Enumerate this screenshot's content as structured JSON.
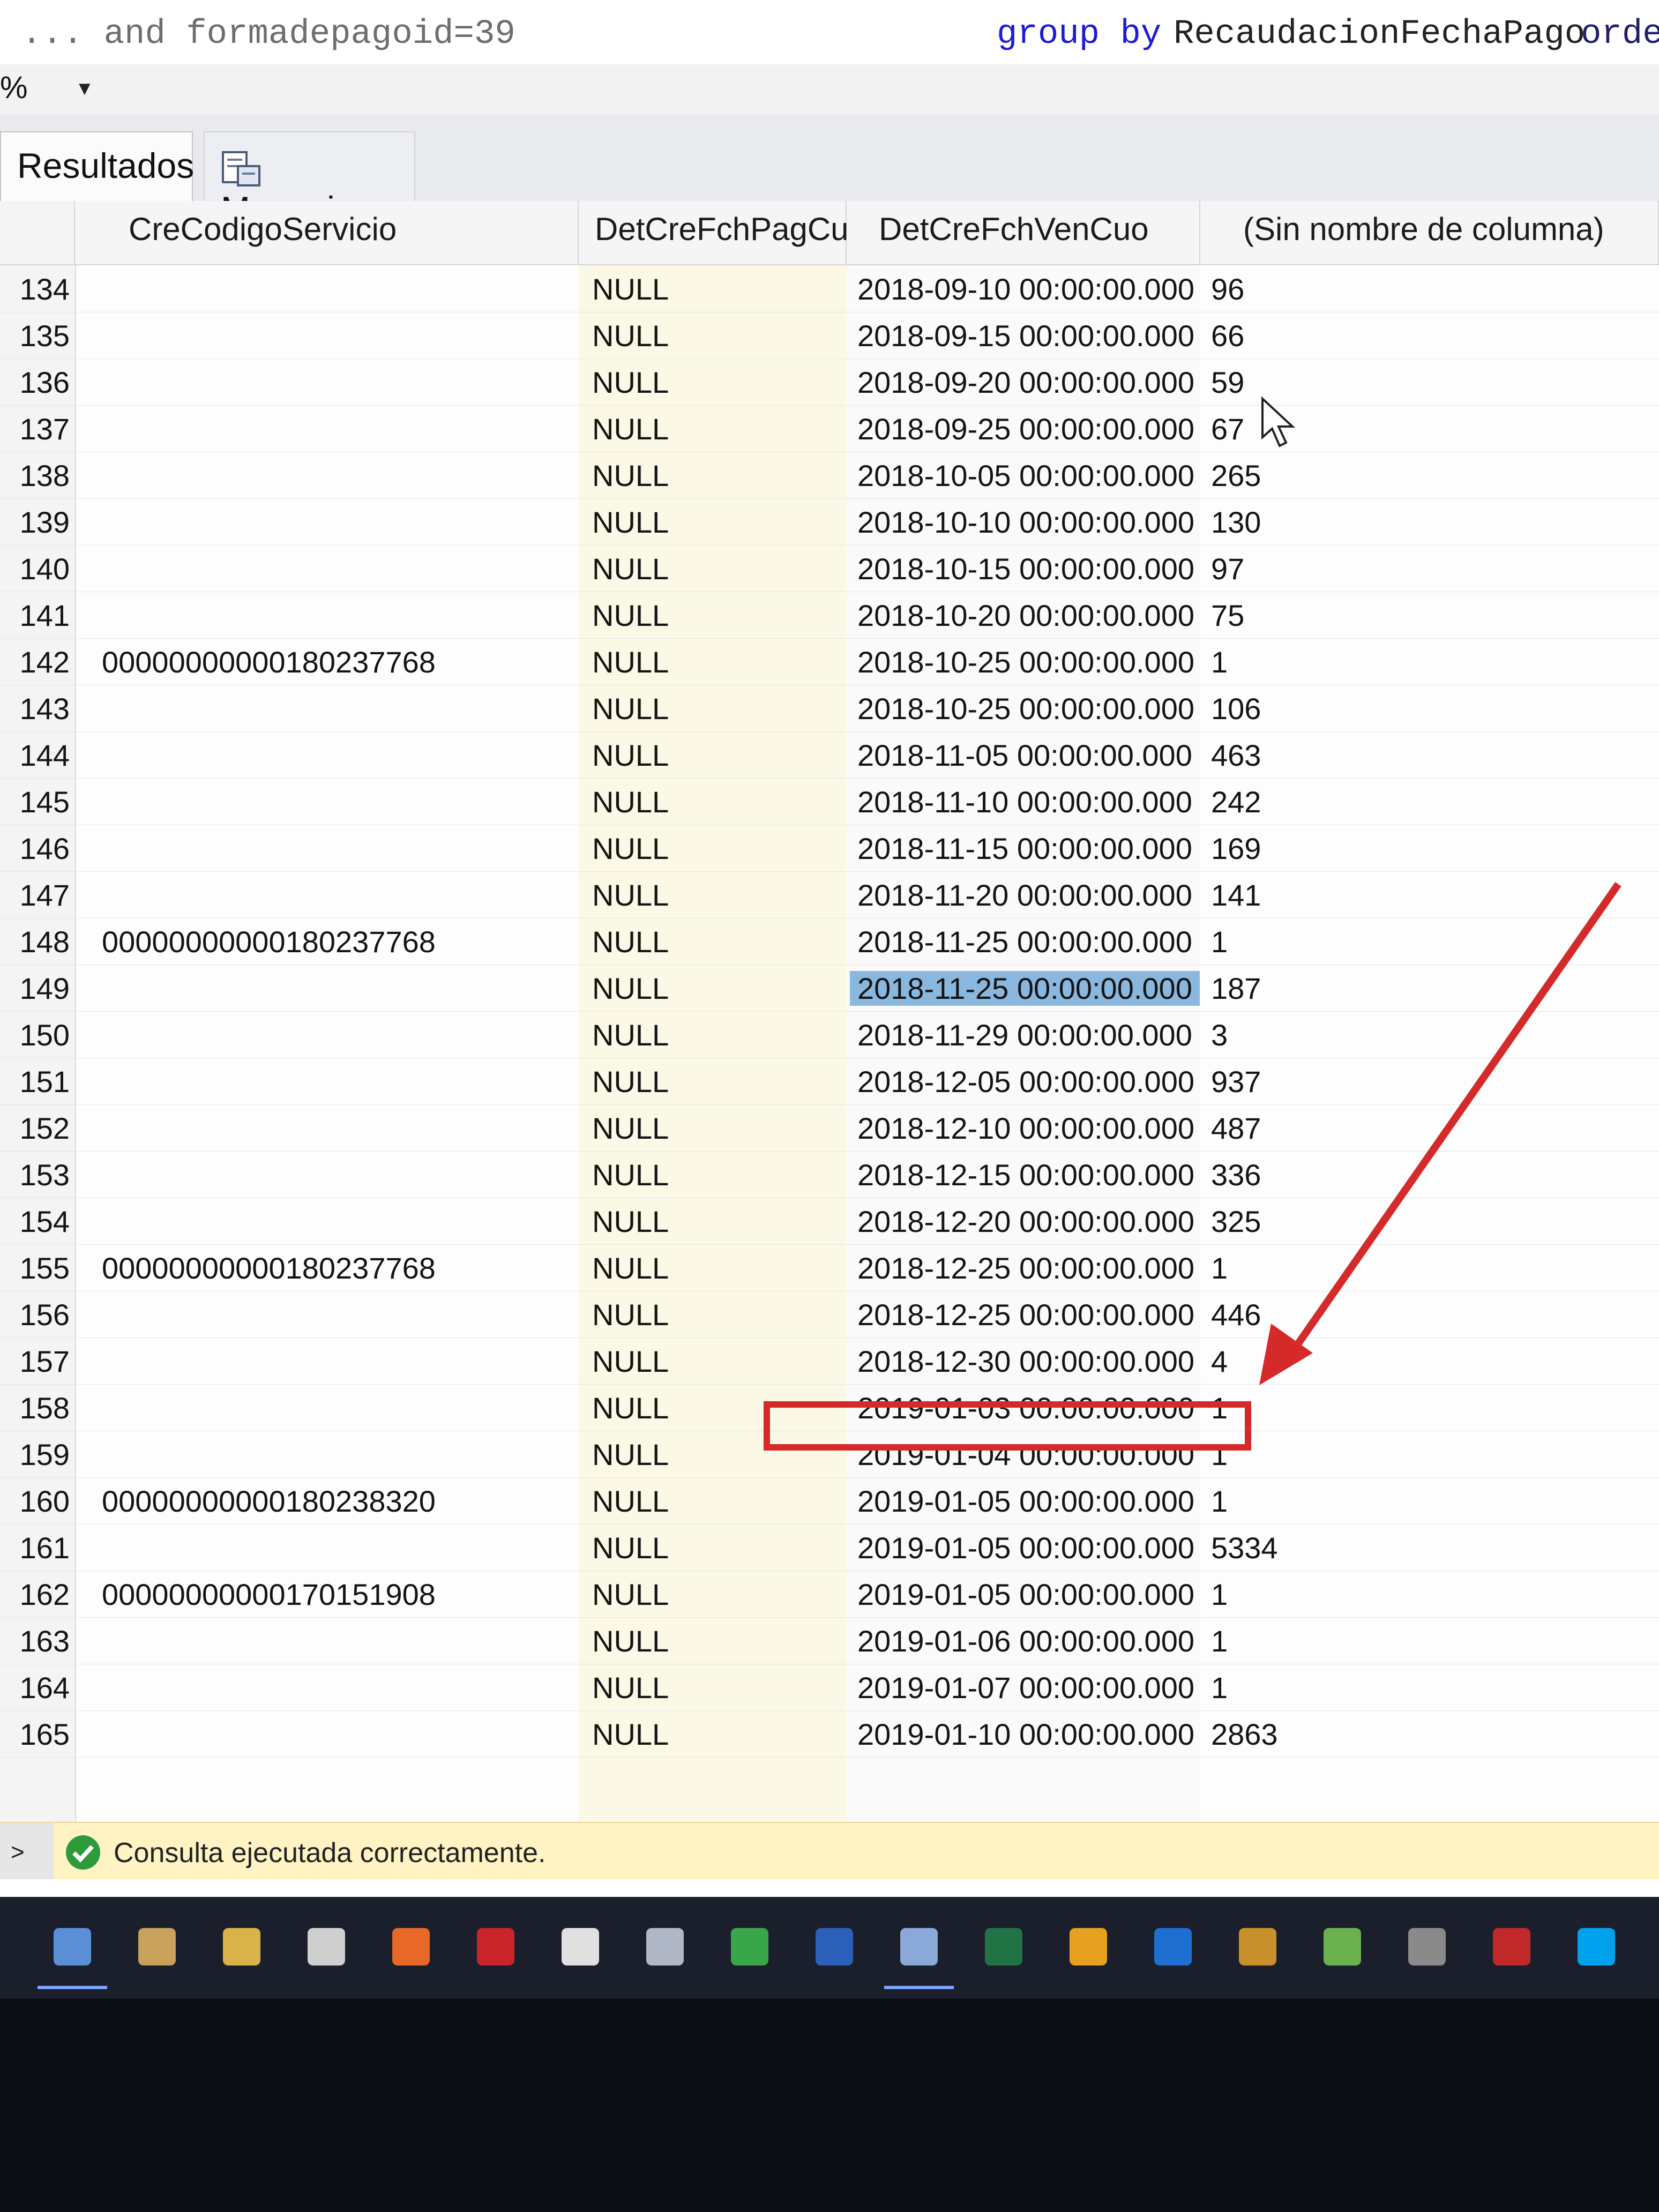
{
  "query_bar": {
    "part1": "... and formadepagoid=39",
    "part2": "group by",
    "part3": "RecaudacionFechaPago",
    "part4": "order"
  },
  "toolbar": {
    "zoom": "%"
  },
  "tabs": [
    {
      "label": "Resultados",
      "active": true
    },
    {
      "label": "Mensajes",
      "active": false
    }
  ],
  "grid": {
    "columns": [
      "CreCodigoServicio",
      "DetCreFchPagCuo",
      "DetCreFchVenCuo",
      "(Sin nombre de columna)"
    ],
    "selected_row": "149",
    "highlighted_row": "157",
    "rows": [
      {
        "n": "134",
        "codigo": "",
        "pag": "NULL",
        "ven": "2018-09-10 00:00:00.000",
        "count": "96"
      },
      {
        "n": "135",
        "codigo": "",
        "pag": "NULL",
        "ven": "2018-09-15 00:00:00.000",
        "count": "66"
      },
      {
        "n": "136",
        "codigo": "",
        "pag": "NULL",
        "ven": "2018-09-20 00:00:00.000",
        "count": "59"
      },
      {
        "n": "137",
        "codigo": "",
        "pag": "NULL",
        "ven": "2018-09-25 00:00:00.000",
        "count": "67"
      },
      {
        "n": "138",
        "codigo": "",
        "pag": "NULL",
        "ven": "2018-10-05 00:00:00.000",
        "count": "265"
      },
      {
        "n": "139",
        "codigo": "",
        "pag": "NULL",
        "ven": "2018-10-10 00:00:00.000",
        "count": "130"
      },
      {
        "n": "140",
        "codigo": "",
        "pag": "NULL",
        "ven": "2018-10-15 00:00:00.000",
        "count": "97"
      },
      {
        "n": "141",
        "codigo": "",
        "pag": "NULL",
        "ven": "2018-10-20 00:00:00.000",
        "count": "75"
      },
      {
        "n": "142",
        "codigo": "00000000000180237768",
        "pag": "NULL",
        "ven": "2018-10-25 00:00:00.000",
        "count": "1"
      },
      {
        "n": "143",
        "codigo": "",
        "pag": "NULL",
        "ven": "2018-10-25 00:00:00.000",
        "count": "106"
      },
      {
        "n": "144",
        "codigo": "",
        "pag": "NULL",
        "ven": "2018-11-05 00:00:00.000",
        "count": "463"
      },
      {
        "n": "145",
        "codigo": "",
        "pag": "NULL",
        "ven": "2018-11-10 00:00:00.000",
        "count": "242"
      },
      {
        "n": "146",
        "codigo": "",
        "pag": "NULL",
        "ven": "2018-11-15 00:00:00.000",
        "count": "169"
      },
      {
        "n": "147",
        "codigo": "",
        "pag": "NULL",
        "ven": "2018-11-20 00:00:00.000",
        "count": "141"
      },
      {
        "n": "148",
        "codigo": "00000000000180237768",
        "pag": "NULL",
        "ven": "2018-11-25 00:00:00.000",
        "count": "1"
      },
      {
        "n": "149",
        "codigo": "",
        "pag": "NULL",
        "ven": "2018-11-25 00:00:00.000",
        "count": "187"
      },
      {
        "n": "150",
        "codigo": "",
        "pag": "NULL",
        "ven": "2018-11-29 00:00:00.000",
        "count": "3"
      },
      {
        "n": "151",
        "codigo": "",
        "pag": "NULL",
        "ven": "2018-12-05 00:00:00.000",
        "count": "937"
      },
      {
        "n": "152",
        "codigo": "",
        "pag": "NULL",
        "ven": "2018-12-10 00:00:00.000",
        "count": "487"
      },
      {
        "n": "153",
        "codigo": "",
        "pag": "NULL",
        "ven": "2018-12-15 00:00:00.000",
        "count": "336"
      },
      {
        "n": "154",
        "codigo": "",
        "pag": "NULL",
        "ven": "2018-12-20 00:00:00.000",
        "count": "325"
      },
      {
        "n": "155",
        "codigo": "00000000000180237768",
        "pag": "NULL",
        "ven": "2018-12-25 00:00:00.000",
        "count": "1"
      },
      {
        "n": "156",
        "codigo": "",
        "pag": "NULL",
        "ven": "2018-12-25 00:00:00.000",
        "count": "446"
      },
      {
        "n": "157",
        "codigo": "",
        "pag": "NULL",
        "ven": "2018-12-30 00:00:00.000",
        "count": "4"
      },
      {
        "n": "158",
        "codigo": "",
        "pag": "NULL",
        "ven": "2019-01-03 00:00:00.000",
        "count": "1"
      },
      {
        "n": "159",
        "codigo": "",
        "pag": "NULL",
        "ven": "2019-01-04 00:00:00.000",
        "count": "1"
      },
      {
        "n": "160",
        "codigo": "00000000000180238320",
        "pag": "NULL",
        "ven": "2019-01-05 00:00:00.000",
        "count": "1"
      },
      {
        "n": "161",
        "codigo": "",
        "pag": "NULL",
        "ven": "2019-01-05 00:00:00.000",
        "count": "5334"
      },
      {
        "n": "162",
        "codigo": "00000000000170151908",
        "pag": "NULL",
        "ven": "2019-01-05 00:00:00.000",
        "count": "1"
      },
      {
        "n": "163",
        "codigo": "",
        "pag": "NULL",
        "ven": "2019-01-06 00:00:00.000",
        "count": "1"
      },
      {
        "n": "164",
        "codigo": "",
        "pag": "NULL",
        "ven": "2019-01-07 00:00:00.000",
        "count": "1"
      },
      {
        "n": "165",
        "codigo": "",
        "pag": "NULL",
        "ven": "2019-01-10 00:00:00.000",
        "count": "2863"
      }
    ]
  },
  "status": {
    "text": "Consulta ejecutada correctamente.",
    "state_color": "#2e9b3a"
  },
  "taskbar": {
    "icons": [
      "globe-icon",
      "file-icon",
      "folder-icon",
      "box-icon",
      "firefox-icon",
      "acrobat-icon",
      "mail-icon",
      "search-icon",
      "s-icon",
      "word-icon",
      "sql-server-icon",
      "excel-icon",
      "chart-icon",
      "outlook-icon",
      "database-icon",
      "notepad-icon",
      "gx-icon",
      "filezilla-icon",
      "skype-icon"
    ]
  },
  "annotation": {
    "color": "#d42a2a"
  }
}
